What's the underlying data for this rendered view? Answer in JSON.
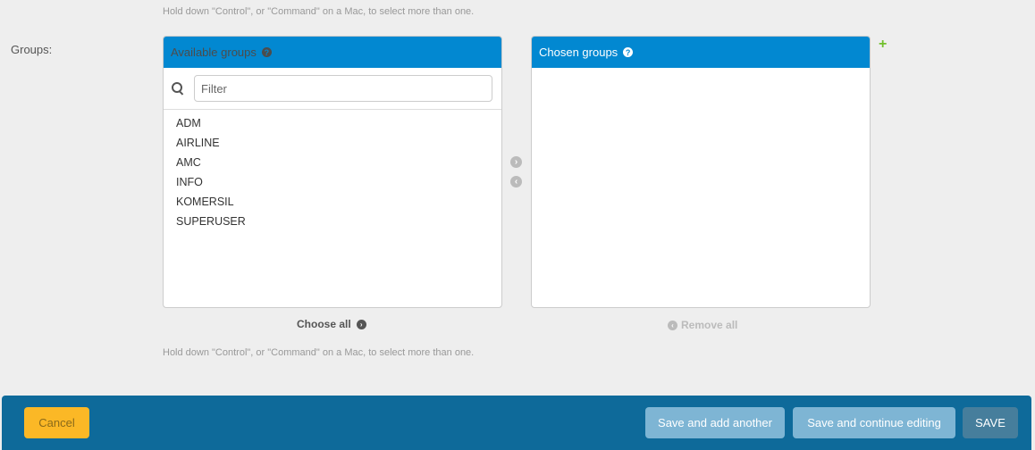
{
  "help_text": "Hold down \"Control\", or \"Command\" on a Mac, to select more than one.",
  "field_label": "Groups:",
  "available": {
    "title": "Available groups",
    "filter_placeholder": "Filter",
    "options": [
      "ADM",
      "AIRLINE",
      "AMC",
      "INFO",
      "KOMERSIL",
      "SUPERUSER"
    ],
    "choose_all_label": "Choose all"
  },
  "chosen": {
    "title": "Chosen groups",
    "options": [],
    "remove_all_label": "Remove all"
  },
  "icons": {
    "help": "question-circle-icon",
    "search": "search-icon",
    "add": "plus-icon",
    "move_right": "arrow-right-circle-icon",
    "move_left": "arrow-left-circle-icon"
  },
  "colors": {
    "header_blue": "#0288d1",
    "submit_bar": "#0e6a9a",
    "cancel": "#fbb826",
    "add_green": "#70bf2b"
  },
  "buttons": {
    "cancel": "Cancel",
    "save_add_another": "Save and add another",
    "save_continue": "Save and continue editing",
    "save": "SAVE"
  }
}
